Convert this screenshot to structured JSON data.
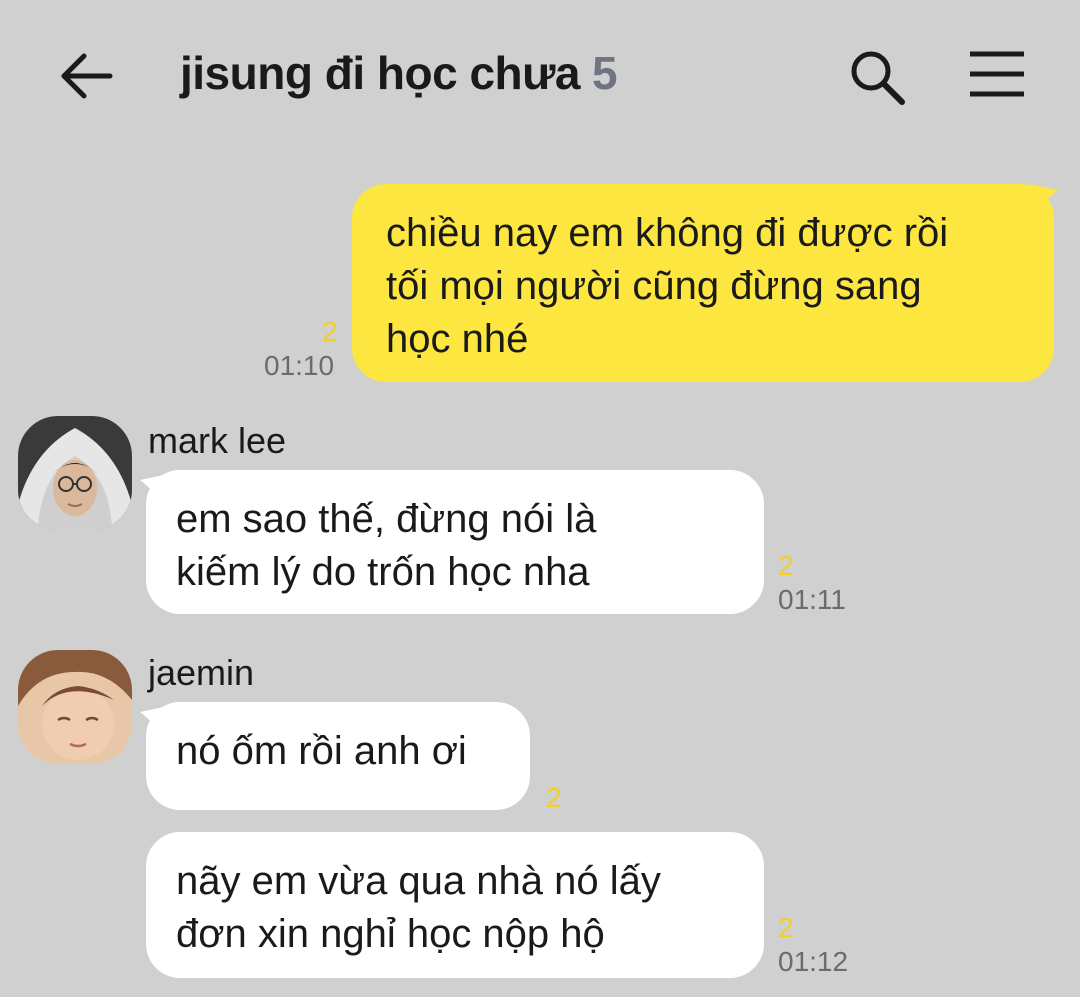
{
  "header": {
    "title": "jisung đi học chưa",
    "member_count": "5",
    "back_icon": "arrow-left-icon",
    "search_icon": "search-icon",
    "menu_icon": "hamburger-menu-icon"
  },
  "colors": {
    "background": "#d0d0d0",
    "my_bubble": "#fde63f",
    "other_bubble": "#ffffff",
    "unread_count": "#f3cf1f"
  },
  "messages": [
    {
      "sender": "me",
      "text": "chiều nay em không đi được rồi\ntối mọi người cũng đừng sang\nhọc nhé",
      "unread": "2",
      "time": "01:10"
    },
    {
      "sender": "mark lee",
      "text": "em sao thế, đừng nói là\nkiếm lý do trốn học nha",
      "unread": "2",
      "time": "01:11"
    },
    {
      "sender": "jaemin",
      "text": "nó ốm rồi anh ơi",
      "unread": "2",
      "time": ""
    },
    {
      "sender": "jaemin",
      "text": "nãy em vừa qua nhà nó lấy\nđơn xin nghỉ học nộp hộ",
      "unread": "2",
      "time": "01:12"
    }
  ]
}
